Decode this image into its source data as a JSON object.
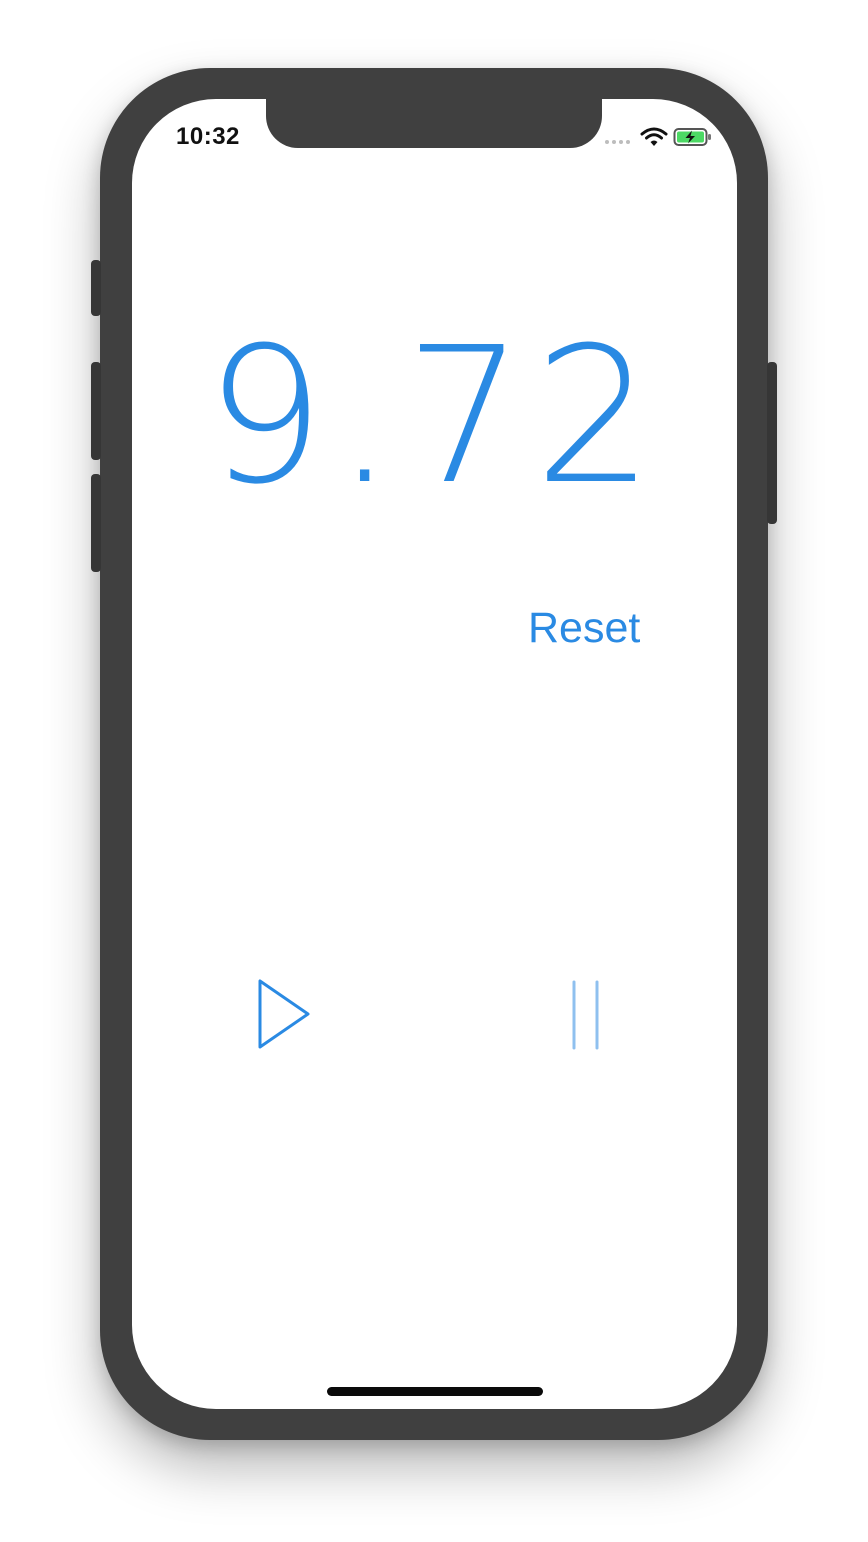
{
  "status_bar": {
    "time": "10:32",
    "signal_icon": "signal-dots-icon",
    "wifi_icon": "wifi-icon",
    "battery_icon": "battery-charging-icon"
  },
  "timer": {
    "value": "9.72"
  },
  "controls": {
    "reset_label": "Reset",
    "play_icon": "play-icon",
    "pause_icon": "pause-icon"
  },
  "colors": {
    "accent": "#2a8ae3",
    "device_frame": "#404040",
    "battery_fill": "#4cd964"
  }
}
